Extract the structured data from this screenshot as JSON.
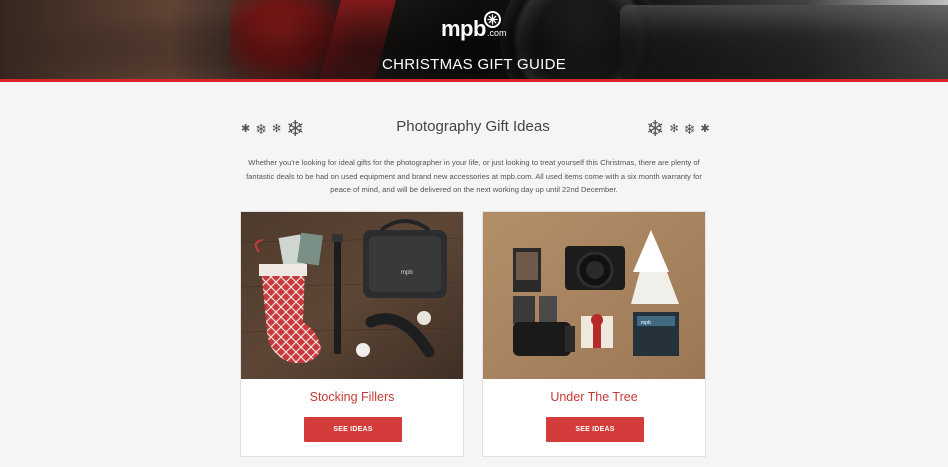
{
  "header": {
    "logo_word": "mpb",
    "logo_suffix": ".com",
    "title": "CHRISTMAS GIFT GUIDE"
  },
  "main": {
    "section_title": "Photography Gift Ideas",
    "intro": "Whether you're looking for ideal gifts for the photographer in your life, or just looking to treat yourself this Christmas, there are plenty of fantastic deals to be had on used equipment and brand new accessories at mpb.com. All used items come with a six month warranty for peace of mind, and will be delivered on the next working day up until 22nd December.",
    "cards": [
      {
        "title": "Stocking Fillers",
        "button_label": "SEE IDEAS"
      },
      {
        "title": "Under The Tree",
        "button_label": "SEE IDEAS"
      }
    ]
  },
  "colors": {
    "accent": "#d43b3b",
    "card_title": "#c83838",
    "header_line": "#d9262b"
  },
  "icons": [
    "snowflake-icon",
    "mpb-logo-flower-icon"
  ]
}
